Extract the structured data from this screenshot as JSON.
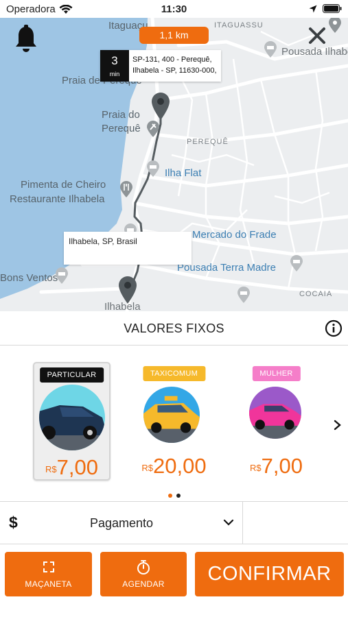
{
  "status_bar": {
    "carrier": "Operadora",
    "time": "11:30"
  },
  "map": {
    "distance": "1,1 km",
    "eta_value": "3",
    "eta_unit": "min",
    "origin_address_line1": "SP-131, 400 - Perequê,",
    "origin_address_line2": "Ilhabela - SP, 11630-000,",
    "destination": "Ilhabela, SP, Brasil",
    "labels": {
      "itaguacu_left": "Itaguaçu",
      "itaguacu_right": "ITAGUASSU",
      "pousada_ilhabela": "Pousada Ilhabela",
      "praia_de_pereque": "Praia de Perequê",
      "praia_do": "Praia do",
      "pereque_beach": "Perequê",
      "pereque_district": "PEREQUÊ",
      "ilha_flat": "Ilha Flat",
      "pimenta_1": "Pimenta de Cheiro",
      "pimenta_2": "Restaurante Ilhabela",
      "mercado": "Mercado do Frade",
      "bons_ventos": "Bons Ventos",
      "pousada_terra": "Pousada Terra Madre",
      "cocaia": "COCAIA",
      "ilhabela_bottom": "Ilhabela"
    },
    "icons": [
      "bell-icon",
      "close-icon",
      "pin-icon",
      "lodging-icon",
      "restaurant-icon",
      "beach-icon"
    ]
  },
  "section": {
    "title": "VALORES FIXOS",
    "info_icon": "info-icon"
  },
  "options": [
    {
      "badge": "PARTICULAR",
      "currency": "R$",
      "price": "7,00",
      "badge_bg": "#111111",
      "badge_fg": "#ffffff",
      "circle_bg": "#6ed6e6",
      "car_color": "#1e3552",
      "selected": true
    },
    {
      "badge": "TAXICOMUM",
      "currency": "R$",
      "price": "20,00",
      "badge_bg": "#f6b92b",
      "badge_fg": "#ffffff",
      "circle_bg": "#33a7e6",
      "car_color": "#f6b92b",
      "selected": false
    },
    {
      "badge": "MULHER",
      "currency": "R$",
      "price": "7,00",
      "badge_bg": "#f57ec9",
      "badge_fg": "#ffffff",
      "circle_bg": "#9b59c9",
      "car_color": "#f0359b",
      "selected": false
    }
  ],
  "pagination": {
    "pages": 2,
    "active": 1
  },
  "payment": {
    "icon": "$",
    "label": "Pagamento"
  },
  "actions": {
    "handle_label": "MAÇANETA",
    "schedule_label": "AGENDAR",
    "confirm_label": "CONFIRMAR"
  },
  "colors": {
    "accent": "#ef6c0f",
    "water": "#9ec5e4",
    "land": "#eceef0"
  }
}
